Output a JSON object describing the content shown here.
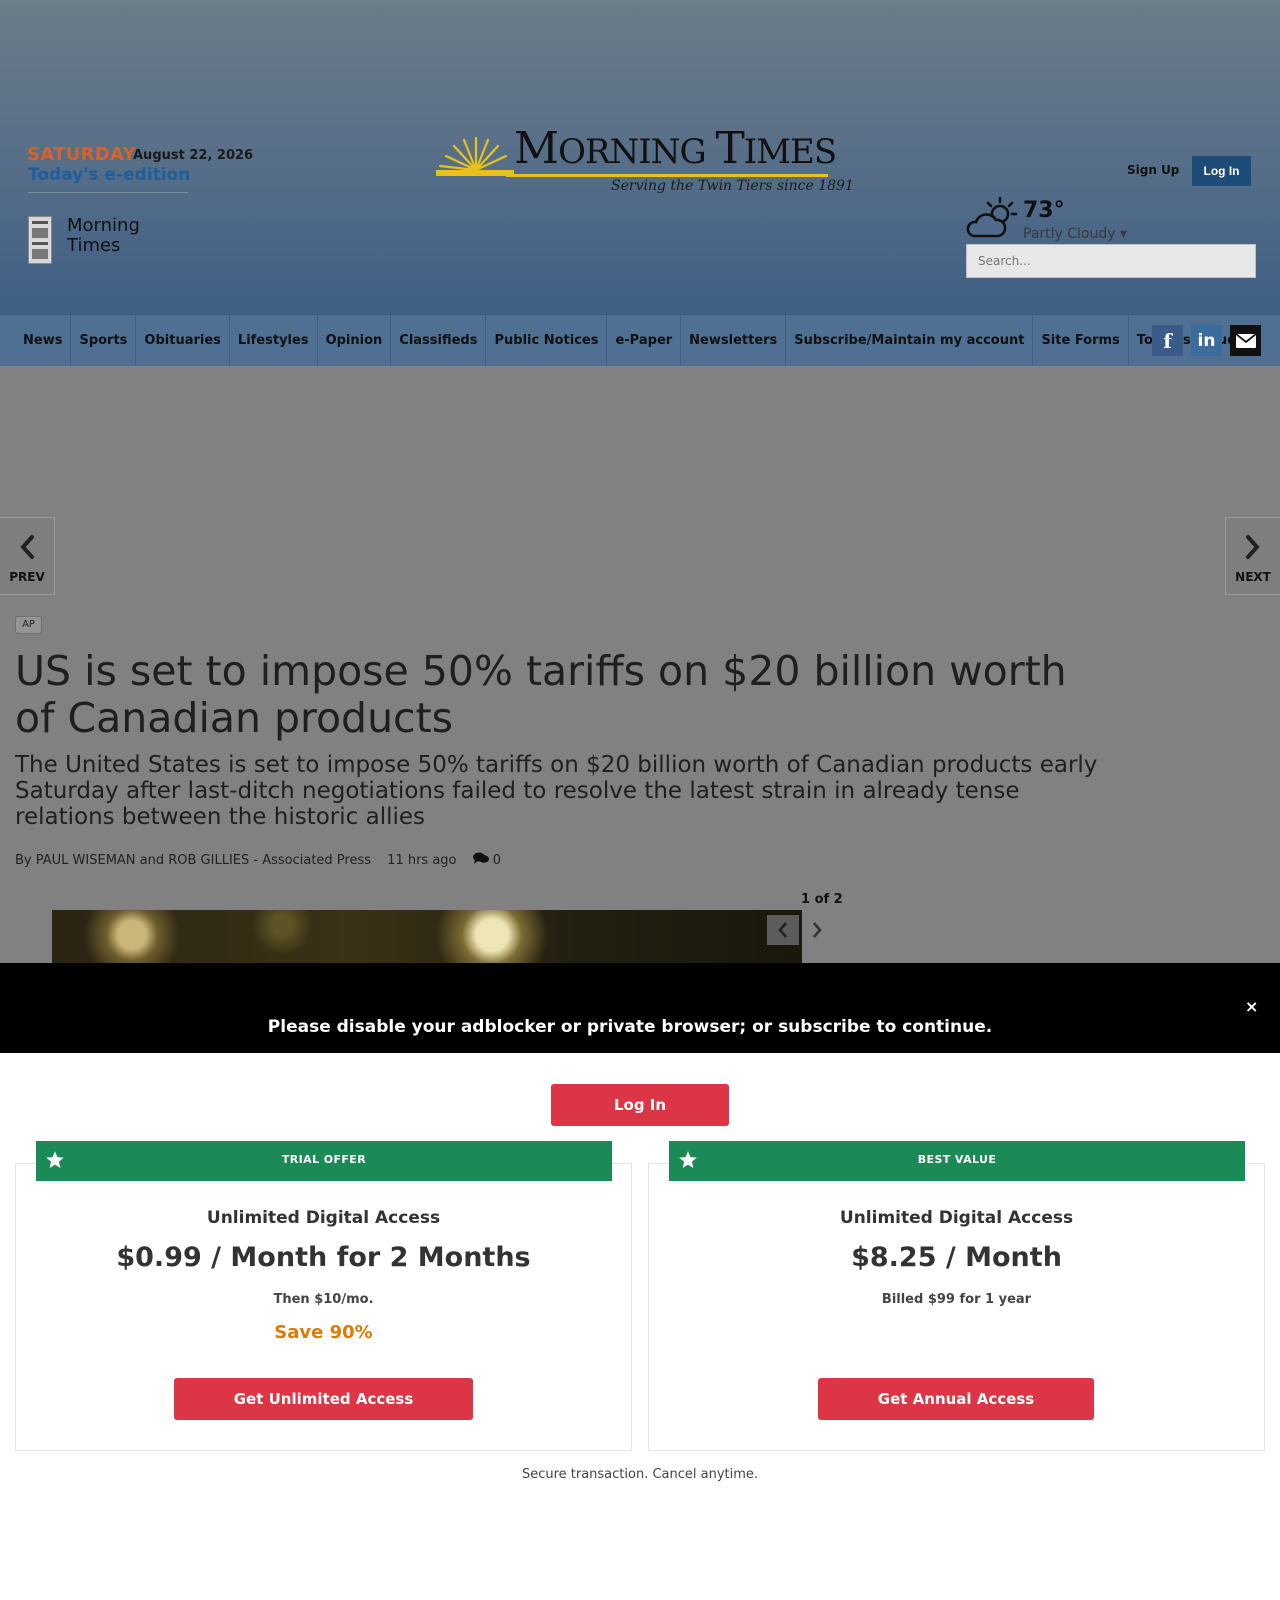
{
  "header": {
    "edition": {
      "day": "SATURDAY",
      "date": "August 22, 2026",
      "link": "Today's e-edition",
      "name": "Morning Times"
    },
    "logo": {
      "title_lead": "M",
      "title_a": "ORNING ",
      "title_b": "T",
      "title_c": "IMES",
      "tagline": "Serving the Twin Tiers since 1891"
    },
    "account": {
      "signup": "Sign Up",
      "login": "Log In"
    },
    "weather": {
      "temp": "73°",
      "condition": "Partly Cloudy ▾",
      "icon": "partly-cloudy-icon"
    },
    "search": {
      "placeholder": "Search..."
    }
  },
  "nav": {
    "items": [
      "News",
      "Sports",
      "Obituaries",
      "Lifestyles",
      "Opinion",
      "Classifieds",
      "Public Notices",
      "e-Paper",
      "Newsletters",
      "Subscribe/Maintain my account",
      "Site Forms",
      "Today's Values"
    ],
    "social": {
      "facebook": "f",
      "linkedin": "in",
      "email_icon": "envelope-icon"
    }
  },
  "article": {
    "prev": "PREV",
    "next": "NEXT",
    "tag": "AP",
    "headline": "US is set to impose 50% tariffs on $20 billion worth of Canadian products",
    "dek": "The United States is set to impose 50% tariffs on $20 billion worth of Canadian products early Saturday after last-ditch negotiations failed to resolve the latest strain in already tense relations between the historic allies",
    "byline": "By PAUL WISEMAN and ROB GILLIES - Associated Press",
    "time": "11 hrs ago",
    "comments": "0",
    "gallery_count": "1 of 2"
  },
  "adblock": {
    "message": "Please disable your adblocker or private browser; or subscribe to continue.",
    "close": "×"
  },
  "paywall": {
    "login": "Log In",
    "offers": [
      {
        "ribbon": "TRIAL OFFER",
        "access": "Unlimited Digital Access",
        "price": "$0.99 / Month for 2 Months",
        "sub": "Then $10/mo.",
        "save": "Save 90%",
        "button": "Get Unlimited Access"
      },
      {
        "ribbon": "BEST VALUE",
        "access": "Unlimited Digital Access",
        "price": "$8.25 / Month",
        "sub": "Billed $99 for 1 year",
        "save": "",
        "button": "Get Annual Access"
      }
    ],
    "secure": "Secure transaction. Cancel anytime."
  },
  "colors": {
    "accent_red": "#dc3545",
    "ribbon_green": "#1b8a57",
    "save_orange": "#df7a06",
    "nav_blue": "#4f6f93",
    "login_blue": "#1c4c77"
  }
}
